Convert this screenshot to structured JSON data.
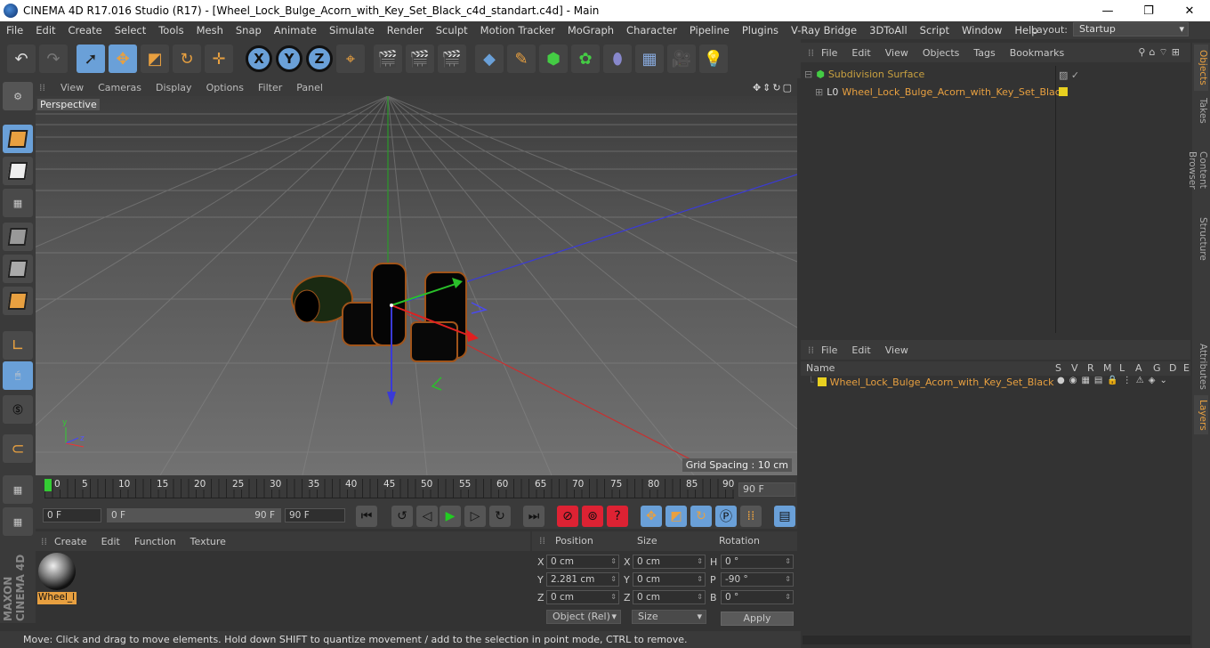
{
  "title": "CINEMA 4D R17.016 Studio (R17) - [Wheel_Lock_Bulge_Acorn_with_Key_Set_Black_c4d_standart.c4d] - Main",
  "menu": [
    "File",
    "Edit",
    "Create",
    "Select",
    "Tools",
    "Mesh",
    "Snap",
    "Animate",
    "Simulate",
    "Render",
    "Sculpt",
    "Motion Tracker",
    "MoGraph",
    "Character",
    "Pipeline",
    "Plugins",
    "V-Ray Bridge",
    "3DToAll",
    "Script",
    "Window",
    "Help"
  ],
  "layout_label": "Layout:",
  "layout_value": "Startup",
  "axis_buttons": [
    "X",
    "Y",
    "Z"
  ],
  "viewport": {
    "menu": [
      "View",
      "Cameras",
      "Display",
      "Options",
      "Filter",
      "Panel"
    ],
    "label": "Perspective",
    "grid_spacing": "Grid Spacing : 10 cm",
    "axis_y": "y",
    "axis_z": "z"
  },
  "timeline": {
    "ticks": [
      "0",
      "5",
      "10",
      "15",
      "20",
      "25",
      "30",
      "35",
      "40",
      "45",
      "50",
      "55",
      "60",
      "65",
      "70",
      "75",
      "80",
      "85",
      "90"
    ],
    "current": "90 F"
  },
  "transport": {
    "start": "0 F",
    "slider_start": "0 F",
    "slider_end": "90 F",
    "end": "90 F"
  },
  "material": {
    "menu": [
      "Create",
      "Edit",
      "Function",
      "Texture"
    ],
    "name": "Wheel_l"
  },
  "coords": {
    "headers": [
      "Position",
      "Size",
      "Rotation"
    ],
    "rows": [
      {
        "axis": "X",
        "pos": "0 cm",
        "saxis": "X",
        "size": "0 cm",
        "raxis": "H",
        "rot": "0 °"
      },
      {
        "axis": "Y",
        "pos": "2.281 cm",
        "saxis": "Y",
        "size": "0 cm",
        "raxis": "P",
        "rot": "-90 °"
      },
      {
        "axis": "Z",
        "pos": "0 cm",
        "saxis": "Z",
        "size": "0 cm",
        "raxis": "B",
        "rot": "0 °"
      }
    ],
    "mode": "Object (Rel)",
    "size_mode": "Size",
    "apply": "Apply"
  },
  "status": "Move: Click and drag to move elements. Hold down SHIFT to quantize movement / add to the selection in point mode, CTRL to remove.",
  "objects": {
    "menu": [
      "File",
      "Edit",
      "View",
      "Objects",
      "Tags",
      "Bookmarks"
    ],
    "items": [
      "Subdivision Surface",
      "Wheel_Lock_Bulge_Acorn_with_Key_Set_Black"
    ]
  },
  "layers": {
    "menu": [
      "File",
      "Edit",
      "View"
    ],
    "name_header": "Name",
    "flags": [
      "S",
      "V",
      "R",
      "M",
      "L",
      "A",
      "G",
      "D",
      "E"
    ],
    "item": "Wheel_Lock_Bulge_Acorn_with_Key_Set_Black"
  },
  "right_tabs": [
    "Objects",
    "Takes",
    "Content Browser",
    "Structure",
    "Attributes",
    "Layers"
  ],
  "brand": "MAXON CINEMA 4D",
  "colors": {
    "accent": "#e8a040",
    "active_blue": "#6aa0d8"
  }
}
